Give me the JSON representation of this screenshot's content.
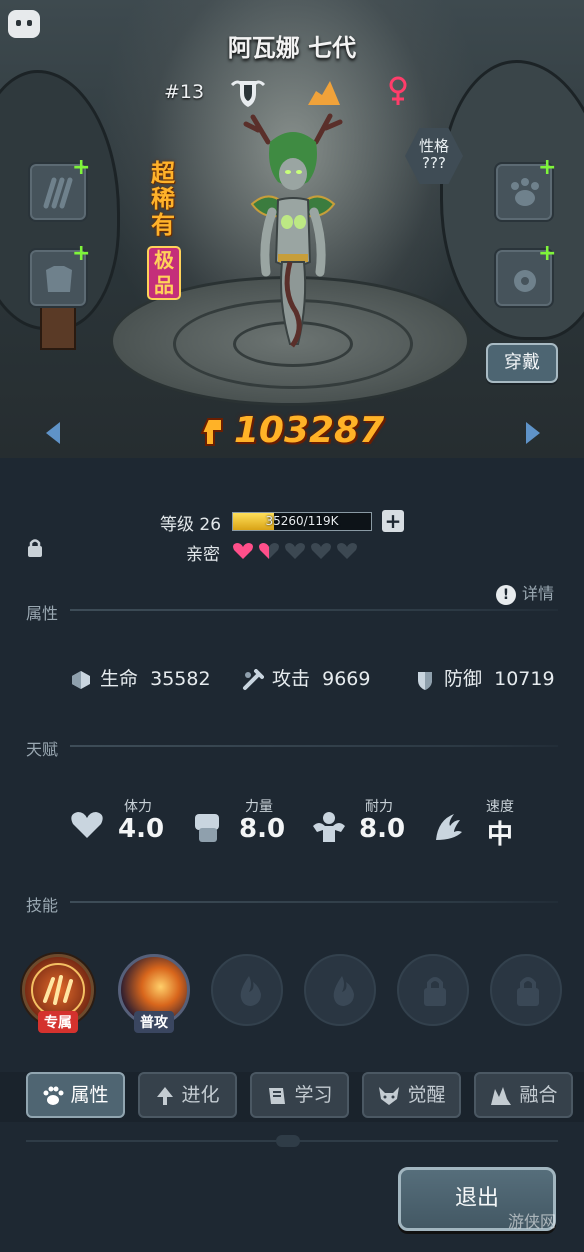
{
  "hero": {
    "name": "阿瓦娜 七代",
    "rank_number": "#13",
    "rarity": "超稀有",
    "grade": "极品",
    "personality_label": "性格",
    "personality_value": "???",
    "gender_icon": "female-icon",
    "power": "103287"
  },
  "buttons": {
    "wear": "穿戴",
    "detail": "详情",
    "exit": "退出"
  },
  "level": {
    "label": "等级 26",
    "exp_text": "35260/119K",
    "exp_fraction": 0.296
  },
  "intimacy": {
    "label": "亲密",
    "hearts": [
      "full",
      "half",
      "empty",
      "empty",
      "empty"
    ],
    "colors": {
      "full": "#ff4f8a",
      "empty": "#3c4852"
    }
  },
  "sections": {
    "attributes": "属性",
    "talents": "天赋",
    "skills": "技能"
  },
  "attributes": [
    {
      "icon": "heart-crystal-icon",
      "label": "生命",
      "value": "35582"
    },
    {
      "icon": "sword-icon",
      "label": "攻击",
      "value": "9669"
    },
    {
      "icon": "shield-icon",
      "label": "防御",
      "value": "10719"
    }
  ],
  "talents": [
    {
      "icon": "heart-icon",
      "label": "体力",
      "value": "4.0"
    },
    {
      "icon": "fist-icon",
      "label": "力量",
      "value": "8.0"
    },
    {
      "icon": "muscle-icon",
      "label": "耐力",
      "value": "8.0"
    },
    {
      "icon": "wing-icon",
      "label": "速度",
      "value": "中"
    }
  ],
  "skills": [
    {
      "type": "own",
      "label": "专属"
    },
    {
      "type": "normal",
      "label": "普攻"
    },
    {
      "type": "empty-flame",
      "label": ""
    },
    {
      "type": "empty-flame",
      "label": ""
    },
    {
      "type": "locked",
      "label": ""
    },
    {
      "type": "locked",
      "label": ""
    }
  ],
  "tabs": [
    {
      "icon": "paw-icon",
      "label": "属性",
      "active": true
    },
    {
      "icon": "arrow-up-icon",
      "label": "进化",
      "active": false
    },
    {
      "icon": "book-icon",
      "label": "学习",
      "active": false
    },
    {
      "icon": "wolf-icon",
      "label": "觉醒",
      "active": false
    },
    {
      "icon": "merge-icon",
      "label": "融合",
      "active": false
    }
  ],
  "watermark": "游侠网",
  "colors": {
    "accent_gold": "#ffb227",
    "rarity_orange": "#ffb22a",
    "plus_green": "#7ff53a",
    "own_skill_red": "#d4322e"
  }
}
